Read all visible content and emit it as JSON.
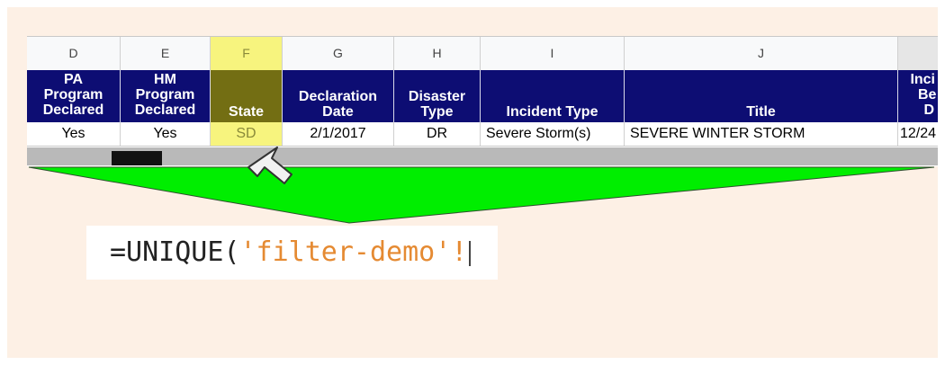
{
  "columns": [
    {
      "letter": "D",
      "header": [
        "PA",
        "Program",
        "Declared"
      ],
      "value": "Yes"
    },
    {
      "letter": "E",
      "header": [
        "HM",
        "Program",
        "Declared"
      ],
      "value": "Yes"
    },
    {
      "letter": "F",
      "header": [
        "State"
      ],
      "value": "SD",
      "selected": true
    },
    {
      "letter": "G",
      "header": [
        "Declaration",
        "Date"
      ],
      "value": "2/1/2017"
    },
    {
      "letter": "H",
      "header": [
        "Disaster",
        "Type"
      ],
      "value": "DR"
    },
    {
      "letter": "I",
      "header": [
        "Incident Type"
      ],
      "value": "Severe Storm(s)"
    },
    {
      "letter": "J",
      "header": [
        "Title"
      ],
      "value": "SEVERE WINTER STORM"
    },
    {
      "letter": "",
      "header": [
        "Inci",
        "Be",
        "D"
      ],
      "value": "12/24"
    }
  ],
  "formula": {
    "function_part": "=UNIQUE(",
    "string_part": "'filter-demo'!"
  },
  "colors": {
    "header_bg": "#0d0d73",
    "selected_col": "#f7f47e",
    "selected_header": "#736e13",
    "arrow_fill": "#00ee00",
    "panel_bg": "#fdf0e5",
    "formula_string": "#e58a32"
  },
  "icons": {
    "pointer": "mouse-pointer-icon"
  }
}
